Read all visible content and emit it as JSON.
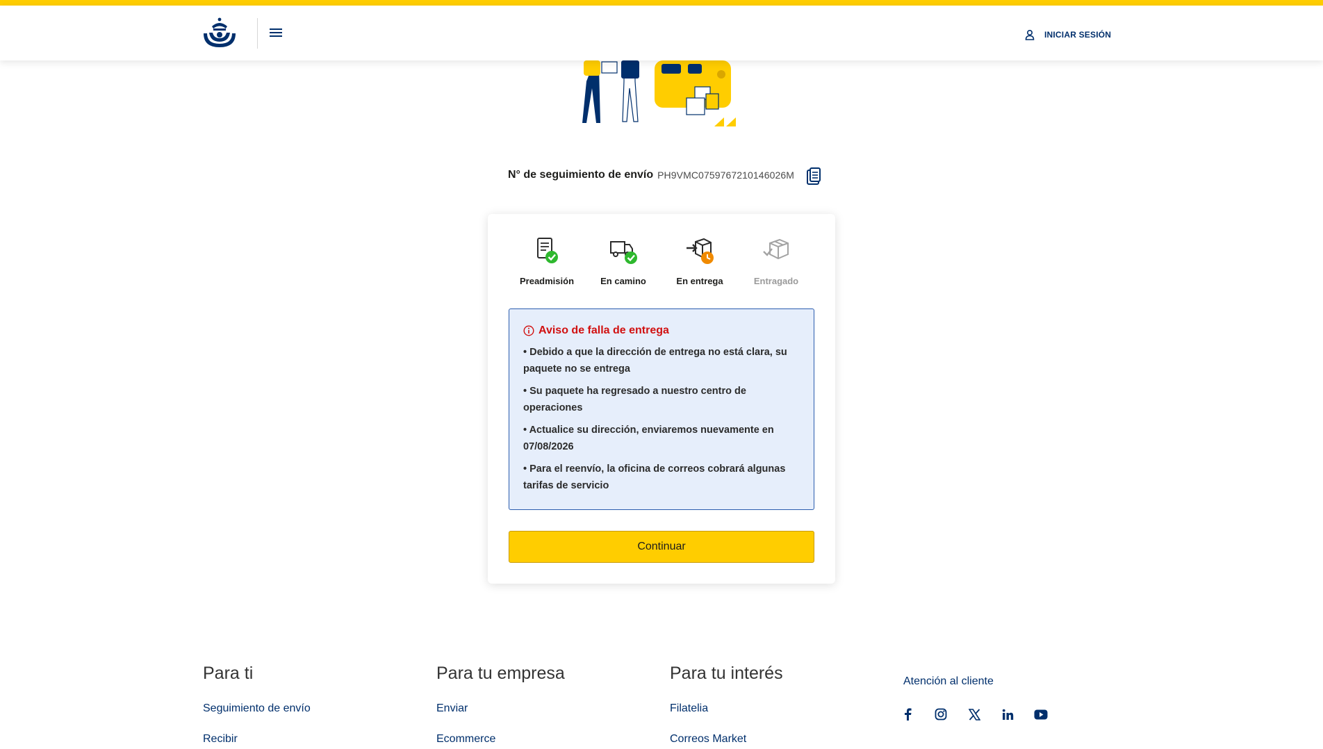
{
  "header": {
    "login_label": "INICIAR SESIÓN"
  },
  "tracking": {
    "label": "N° de seguimiento de envío",
    "number": "PH9VMC0759767210146026M"
  },
  "steps": [
    {
      "label": "Preadmisión",
      "icon": "document-check-icon",
      "status": "done"
    },
    {
      "label": "En camino",
      "icon": "truck-check-icon",
      "status": "done"
    },
    {
      "label": "En entrega",
      "icon": "delivery-clock-icon",
      "status": "in-progress"
    },
    {
      "label": "Entragado",
      "icon": "box-icon",
      "status": "pending"
    }
  ],
  "notice": {
    "title": "Aviso de falla de entrega",
    "items": [
      "• Debido a que la dirección de entrega no está clara, su paquete no se entrega",
      "• Su paquete ha regresado a nuestro centro de operaciones",
      "• Actualice su dirección, enviaremos nuevamente en 07/08/2026",
      "• Para el reenvío, la oficina de correos cobrará algunas tarifas de servicio"
    ]
  },
  "continue_label": "Continuar",
  "footer": {
    "columns": [
      {
        "heading": "Para ti",
        "links": [
          "Seguimiento de envío",
          "Recibir"
        ]
      },
      {
        "heading": "Para tu empresa",
        "links": [
          "Enviar",
          "Ecommerce"
        ]
      },
      {
        "heading": "Para tu interés",
        "links": [
          "Filatelia",
          "Correos Market"
        ]
      }
    ],
    "atencion": "Atención al cliente",
    "social": [
      "facebook-icon",
      "instagram-icon",
      "x-icon",
      "linkedin-icon",
      "youtube-icon"
    ]
  },
  "colors": {
    "brand_yellow": "#ffcd00",
    "brand_blue": "#002f6c",
    "success_green": "#2eb82e",
    "progress_orange": "#f08a00",
    "alert_red": "#d11010"
  }
}
